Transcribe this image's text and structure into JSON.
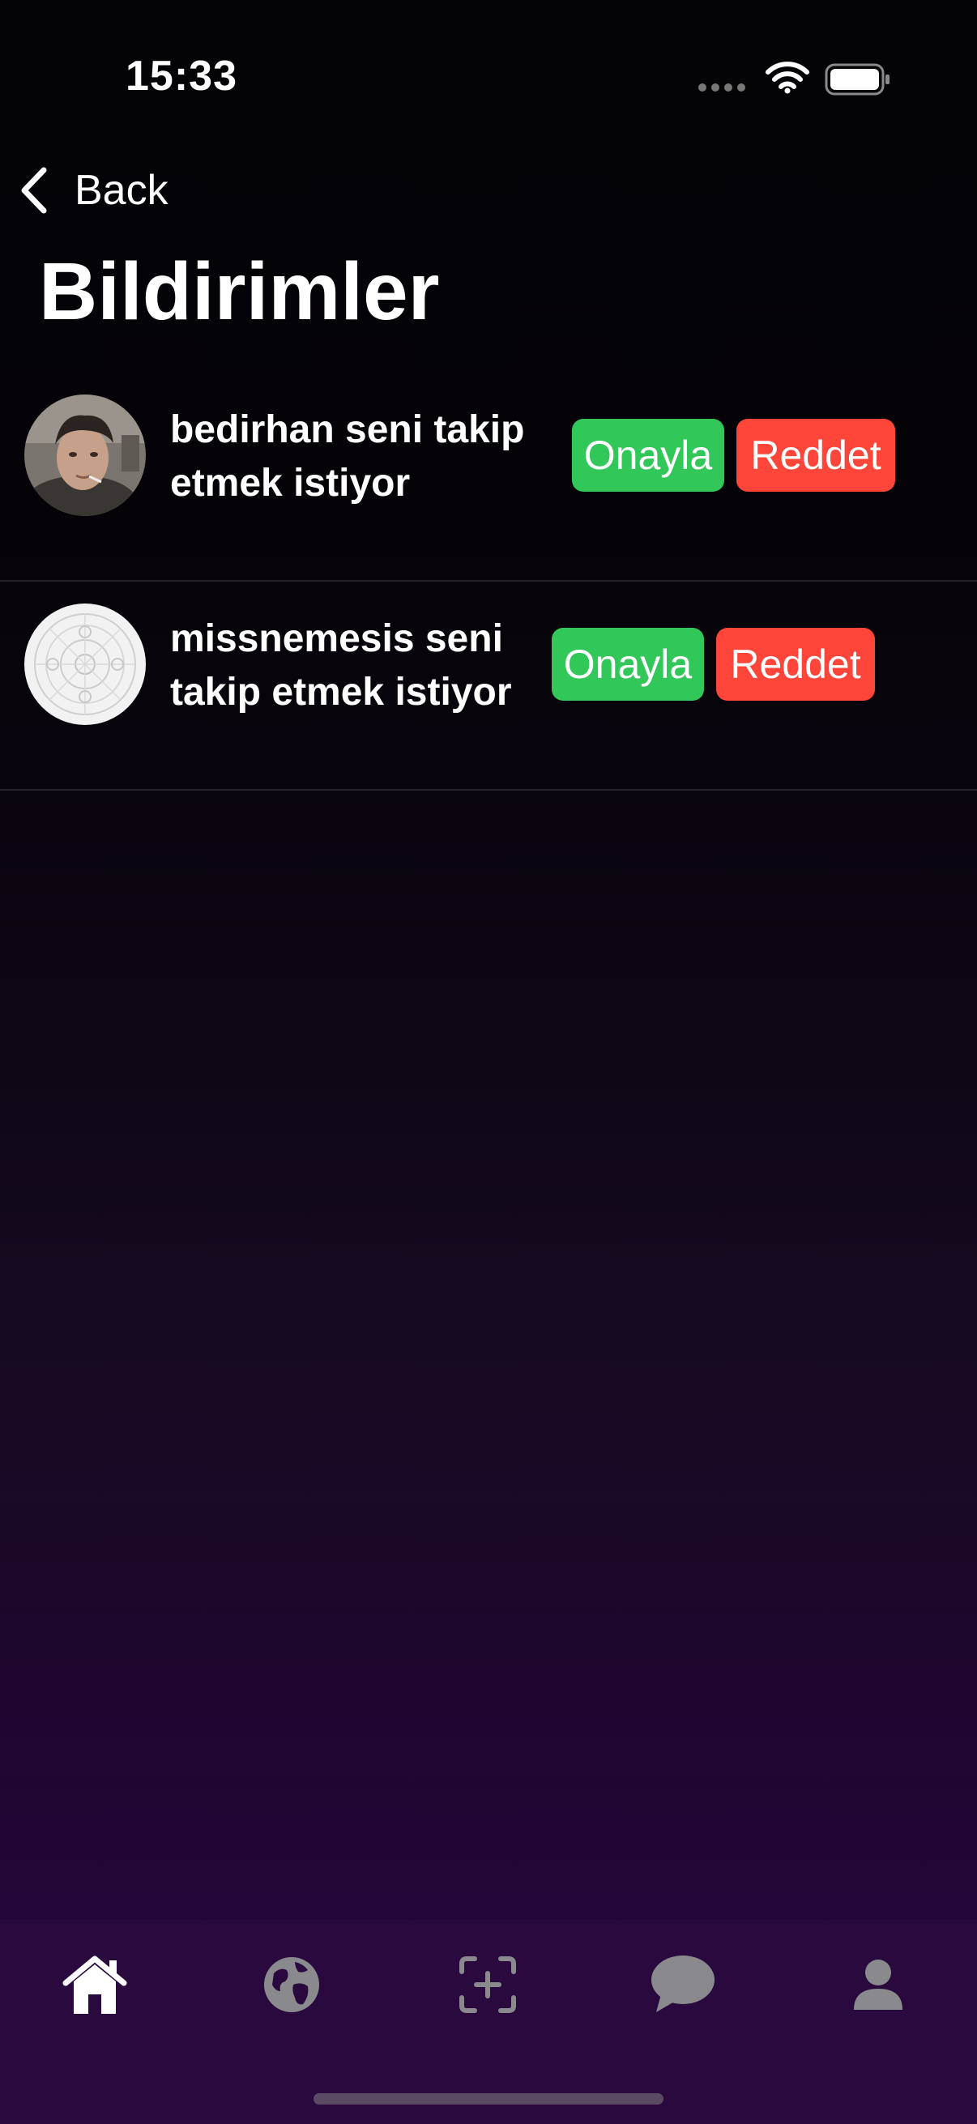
{
  "status_bar": {
    "time": "15:33"
  },
  "nav": {
    "back_label": "Back",
    "title": "Bildirimler"
  },
  "notifications": [
    {
      "line1": "bedirhan seni takip",
      "line2": "etmek istiyor",
      "approve_label": "Onayla",
      "reject_label": "Reddet"
    },
    {
      "line1": "missnemesis seni",
      "line2": "takip etmek istiyor",
      "approve_label": "Onayla",
      "reject_label": "Reddet"
    }
  ],
  "tab_bar": {
    "items": [
      {
        "icon": "home-icon",
        "active": true
      },
      {
        "icon": "globe-icon",
        "active": false
      },
      {
        "icon": "add-post-icon",
        "active": false
      },
      {
        "icon": "chat-bubble-icon",
        "active": false
      },
      {
        "icon": "profile-icon",
        "active": false
      }
    ]
  },
  "colors": {
    "approve": "#32c759",
    "reject": "#fe453a",
    "tab_bar_bg": "#2a0a3e",
    "background_top": "#040306",
    "background_bottom": "#2a0640"
  }
}
